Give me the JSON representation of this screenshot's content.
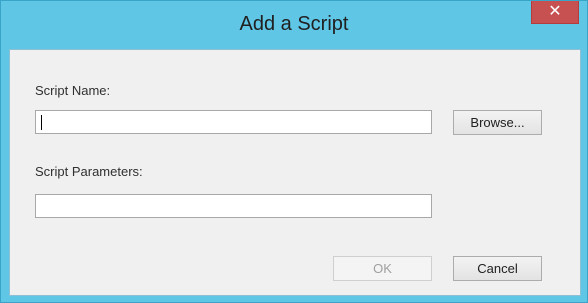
{
  "window": {
    "title": "Add a Script",
    "close_glyph": "✕"
  },
  "form": {
    "script_name_label": "Script Name:",
    "script_name_value": "",
    "script_parameters_label": "Script Parameters:",
    "script_parameters_value": ""
  },
  "buttons": {
    "browse_label": "Browse...",
    "ok_label": "OK",
    "ok_enabled": false,
    "cancel_label": "Cancel"
  },
  "colors": {
    "titlebar": "#5fc6e6",
    "close_button": "#c75050",
    "client_bg": "#f0f0f0"
  }
}
